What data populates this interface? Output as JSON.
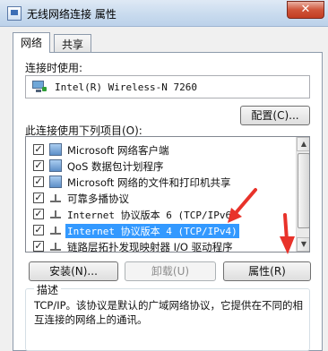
{
  "window": {
    "title": "无线网络连接 属性",
    "close_glyph": "✕"
  },
  "tabs": [
    {
      "label": "网络",
      "active": true
    },
    {
      "label": "共享",
      "active": false
    }
  ],
  "connect_using": {
    "label": "连接时使用:",
    "adapter": "Intel(R) Wireless-N 7260",
    "configure_button": "配置(C)..."
  },
  "items_section": {
    "label": "此连接使用下列项目(O):",
    "items": [
      {
        "label": "Microsoft 网络客户端",
        "checked": true,
        "icon": "network-client-icon",
        "selected": false
      },
      {
        "label": "QoS 数据包计划程序",
        "checked": true,
        "icon": "qos-scheduler-icon",
        "selected": false
      },
      {
        "label": "Microsoft 网络的文件和打印机共享",
        "checked": true,
        "icon": "file-printer-sharing-icon",
        "selected": false
      },
      {
        "label": "可靠多播协议",
        "checked": true,
        "icon": "protocol-icon",
        "selected": false
      },
      {
        "label": "Internet 协议版本 6 (TCP/IPv6)",
        "checked": true,
        "icon": "protocol-icon",
        "selected": false
      },
      {
        "label": "Internet 协议版本 4 (TCP/IPv4)",
        "checked": true,
        "icon": "protocol-icon",
        "selected": true
      },
      {
        "label": "链路层拓扑发现映射器 I/O 驱动程序",
        "checked": true,
        "icon": "protocol-icon",
        "selected": false
      }
    ]
  },
  "buttons": {
    "install": "安装(N)...",
    "uninstall": "卸载(U)",
    "properties": "属性(R)"
  },
  "description": {
    "title": "描述",
    "text": "TCP/IP。该协议是默认的广域网络协议，它提供在不同的相互连接的网络上的通讯。"
  },
  "colors": {
    "selection": "#3399ff",
    "annotation_arrow": "#e8322a"
  }
}
